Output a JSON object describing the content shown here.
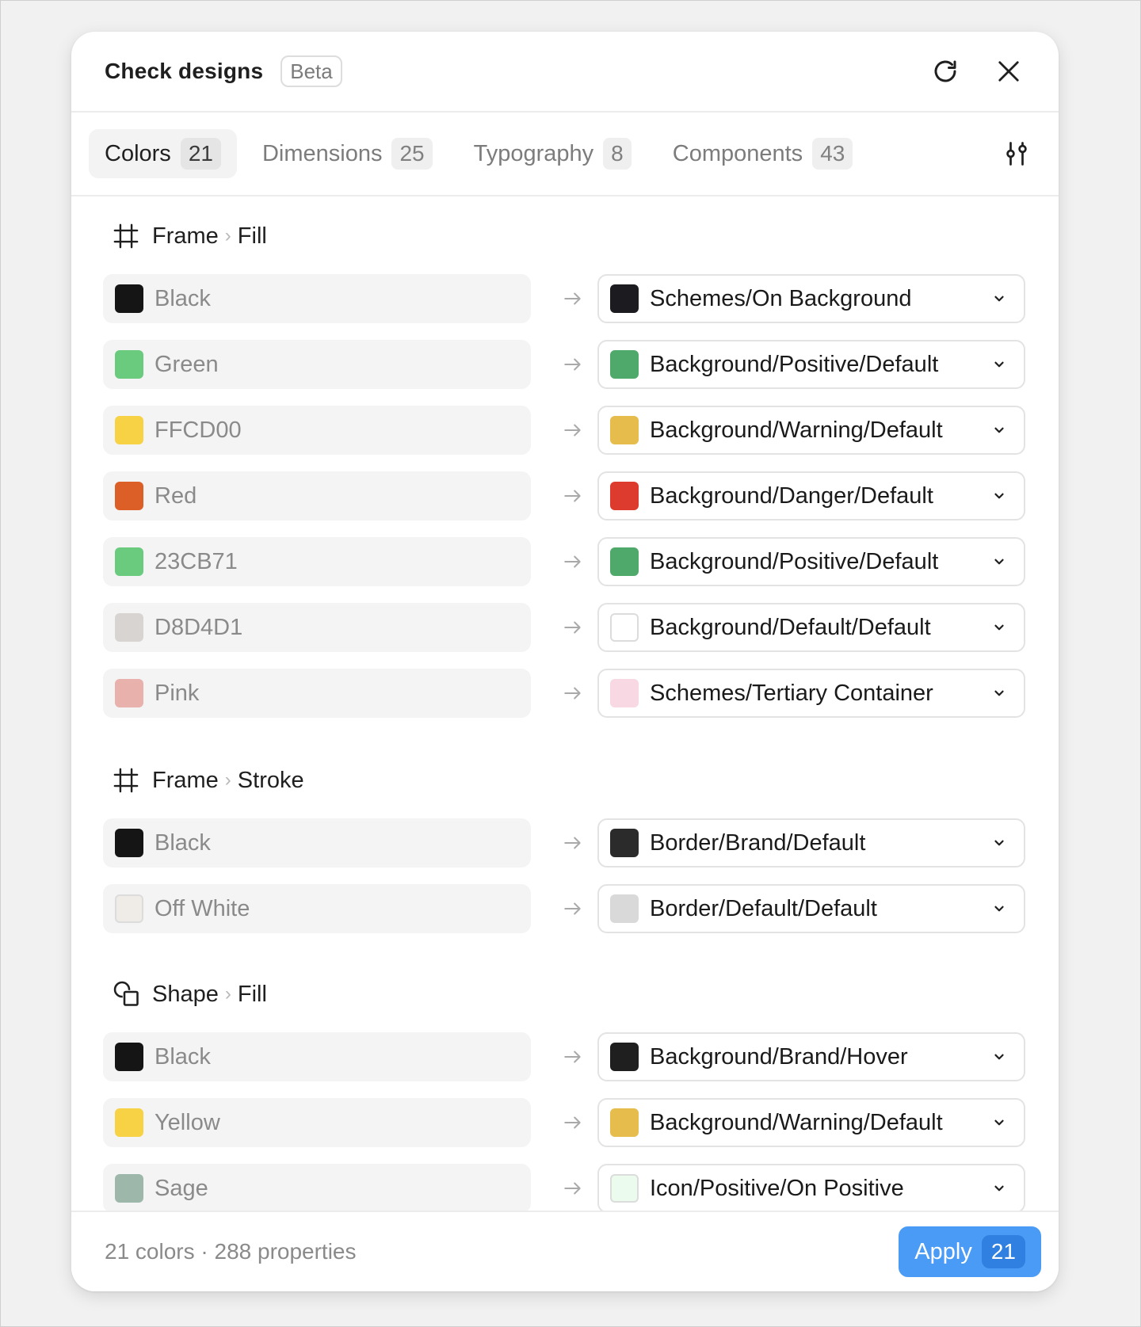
{
  "header": {
    "title": "Check designs",
    "badge": "Beta"
  },
  "tabs": [
    {
      "label": "Colors",
      "count": "21",
      "active": true
    },
    {
      "label": "Dimensions",
      "count": "25",
      "active": false
    },
    {
      "label": "Typography",
      "count": "8",
      "active": false
    },
    {
      "label": "Components",
      "count": "43",
      "active": false
    }
  ],
  "sections": [
    {
      "icon": "frame-icon",
      "layer": "Frame",
      "property": "Fill",
      "rows": [
        {
          "source": "Black",
          "source_color": "#151515",
          "target": "Schemes/On Background",
          "target_color": "#1c1b1f"
        },
        {
          "source": "Green",
          "source_color": "#6acb7e",
          "target": "Background/Positive/Default",
          "target_color": "#4fa96a"
        },
        {
          "source": "FFCD00",
          "source_color": "#f8d245",
          "target": "Background/Warning/Default",
          "target_color": "#e6bd4c"
        },
        {
          "source": "Red",
          "source_color": "#dc5f27",
          "target": "Background/Danger/Default",
          "target_color": "#dc3b2e"
        },
        {
          "source": "23CB71",
          "source_color": "#6acb7e",
          "target": "Background/Positive/Default",
          "target_color": "#4fa96a"
        },
        {
          "source": "D8D4D1",
          "source_color": "#d8d4d1",
          "target": "Background/Default/Default",
          "target_color": "#ffffff"
        },
        {
          "source": "Pink",
          "source_color": "#e8b1ac",
          "target": "Schemes/Tertiary Container",
          "target_color": "#f8d8e2"
        }
      ]
    },
    {
      "icon": "frame-icon",
      "layer": "Frame",
      "property": "Stroke",
      "rows": [
        {
          "source": "Black",
          "source_color": "#151515",
          "target": "Border/Brand/Default",
          "target_color": "#2b2b2b"
        },
        {
          "source": "Off White",
          "source_color": "#efebe7",
          "target": "Border/Default/Default",
          "target_color": "#d9d9d9"
        }
      ]
    },
    {
      "icon": "shape-icon",
      "layer": "Shape",
      "property": "Fill",
      "rows": [
        {
          "source": "Black",
          "source_color": "#151515",
          "target": "Background/Brand/Hover",
          "target_color": "#1f1f1f"
        },
        {
          "source": "Yellow",
          "source_color": "#f8d245",
          "target": "Background/Warning/Default",
          "target_color": "#e6bd4c"
        },
        {
          "source": "Sage",
          "source_color": "#9db8ab",
          "target": "Icon/Positive/On Positive",
          "target_color": "#ebfbee"
        }
      ]
    }
  ],
  "footer": {
    "summary": "21 colors · 288 properties",
    "apply_label": "Apply",
    "apply_count": "21"
  }
}
